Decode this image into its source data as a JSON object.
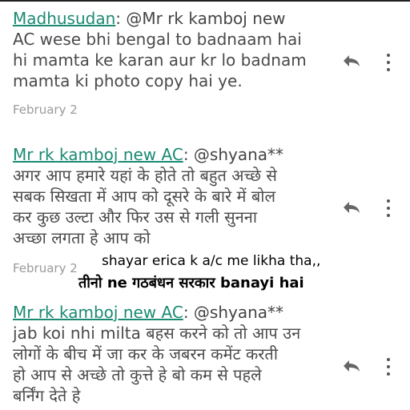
{
  "comments": [
    {
      "author": "Madhusudan",
      "mention": ": @Mr rk kamboj new",
      "body": "AC wese bhi bengal to badnaam hai\nhi mamta ke karan aur kr lo badnam\nmamta ki photo copy  hai ye.",
      "date": "February 2"
    },
    {
      "author": "Mr rk kamboj new AC",
      "mention": ": @shyana**",
      "body": "अगर आप हमारे यहां के होते तो बहुत अच्छे से\nसबक सिखता में आप को दूसरे के बारे में बोल\nकर कुछ उल्टा और फिर उस से गली सुनना\nअच्छा लगता हे आप को",
      "date": "February 2"
    },
    {
      "author": "Mr rk kamboj new AC",
      "mention": ": @shyana**",
      "body": "jab koi nhi milta बहस करने को तो आप उन\nलोगों के बीच में जा कर के जबरन कमेंट करती\nहो आप से अच्छे तो कुत्ते हे बो कम से पहले\nबर्निंग देते हे"
    }
  ],
  "overlay": {
    "line1": "shayar erica k a/c me likha tha,,",
    "line2": "तीनो ne गठबंधन सरकार banayi hai"
  },
  "icons": {
    "reply": "reply-arrow-icon",
    "more": "more-vertical-icon"
  },
  "colors": {
    "author": "#1b8a73",
    "date": "#9a9a9a",
    "text": "#4a4a4a"
  }
}
